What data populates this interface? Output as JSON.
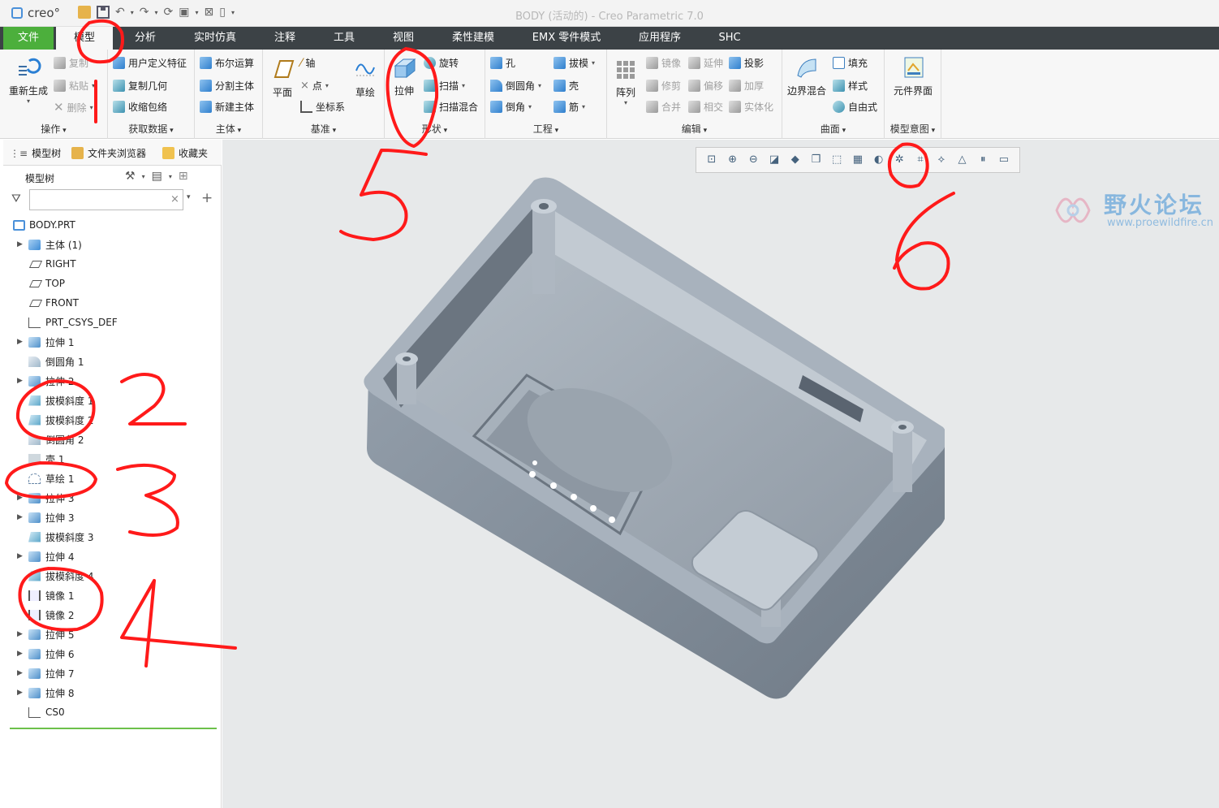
{
  "window": {
    "title": "BODY (活动的) - Creo Parametric 7.0",
    "app_logo": "creo°"
  },
  "ribbon_tabs": [
    "文件",
    "模型",
    "分析",
    "实时仿真",
    "注释",
    "工具",
    "视图",
    "柔性建模",
    "EMX 零件模式",
    "应用程序",
    "SHC"
  ],
  "ribbon": {
    "operations": {
      "label": "操作",
      "regenerate": "重新生成",
      "copy": "复制",
      "paste": "粘贴",
      "delete": "删除"
    },
    "get_data": {
      "label": "获取数据",
      "udf": "用户定义特征",
      "copy_geom": "复制几何",
      "shrinkwrap": "收缩包络"
    },
    "body": {
      "label": "主体",
      "boolean": "布尔运算",
      "split": "分割主体",
      "new_body": "新建主体"
    },
    "datum": {
      "label": "基准",
      "plane": "平面",
      "axis": "轴",
      "point": "点",
      "csys": "坐标系",
      "sketch": "草绘"
    },
    "shapes": {
      "label": "形状",
      "extrude": "拉伸",
      "revolve": "旋转",
      "sweep": "扫描",
      "swept_blend": "扫描混合"
    },
    "engineering": {
      "label": "工程",
      "hole": "孔",
      "round": "倒圆角",
      "chamfer": "倒角",
      "draft": "拔模",
      "shell": "壳",
      "rib": "筋"
    },
    "editing": {
      "label": "编辑",
      "pattern": "阵列",
      "mirror": "镜像",
      "extend": "延伸",
      "project": "投影",
      "trim": "修剪",
      "offset": "偏移",
      "thicken": "加厚",
      "merge": "合并",
      "intersect": "相交",
      "solidify": "实体化"
    },
    "surfaces": {
      "label": "曲面",
      "boundary_blend": "边界混合",
      "fill": "填充",
      "style": "样式",
      "freestyle": "自由式"
    },
    "model_intent": {
      "label": "模型意图",
      "component_interface": "元件界面"
    }
  },
  "nav_tabs": {
    "model_tree": "模型树",
    "folder_browser": "文件夹浏览器",
    "favorites": "收藏夹"
  },
  "tree": {
    "title": "模型树",
    "search_placeholder": "",
    "items": [
      {
        "label": "BODY.PRT",
        "icon": "part-icon",
        "expand": false
      },
      {
        "label": "主体 (1)",
        "icon": "body-icon",
        "expand": true
      },
      {
        "label": "RIGHT",
        "icon": "datum-plane-icon",
        "expand": false
      },
      {
        "label": "TOP",
        "icon": "datum-plane-icon",
        "expand": false
      },
      {
        "label": "FRONT",
        "icon": "datum-plane-icon",
        "expand": false
      },
      {
        "label": "PRT_CSYS_DEF",
        "icon": "csys-icon",
        "expand": false
      },
      {
        "label": "拉伸 1",
        "icon": "extrude-icon",
        "expand": true
      },
      {
        "label": "倒圆角 1",
        "icon": "round-icon",
        "expand": false
      },
      {
        "label": "拉伸 2",
        "icon": "extrude-icon",
        "expand": true
      },
      {
        "label": "拔模斜度 1",
        "icon": "draft-icon",
        "expand": false
      },
      {
        "label": "拔模斜度 2",
        "icon": "draft-icon",
        "expand": false
      },
      {
        "label": "倒圆角 2",
        "icon": "round-icon",
        "expand": false
      },
      {
        "label": "壳 1",
        "icon": "shell-icon",
        "expand": false
      },
      {
        "label": "草绘 1",
        "icon": "sketch-icon",
        "expand": false
      },
      {
        "label": "拉伸 3",
        "icon": "extrude-icon",
        "expand": true
      },
      {
        "label": "拉伸 3",
        "icon": "extrude-icon",
        "expand": true
      },
      {
        "label": "拔模斜度 3",
        "icon": "draft-icon",
        "expand": false
      },
      {
        "label": "拉伸 4",
        "icon": "extrude-icon",
        "expand": true
      },
      {
        "label": "拔模斜度 4",
        "icon": "draft-icon",
        "expand": false
      },
      {
        "label": "镜像 1",
        "icon": "mirror-icon",
        "expand": false
      },
      {
        "label": "镜像 2",
        "icon": "mirror-icon",
        "expand": false
      },
      {
        "label": "拉伸 5",
        "icon": "extrude-icon",
        "expand": true
      },
      {
        "label": "拉伸 6",
        "icon": "extrude-icon",
        "expand": true
      },
      {
        "label": "拉伸 7",
        "icon": "extrude-icon",
        "expand": true
      },
      {
        "label": "拉伸 8",
        "icon": "extrude-icon",
        "expand": true
      },
      {
        "label": "CS0",
        "icon": "csys-icon",
        "expand": false
      }
    ]
  },
  "annotations": [
    "1",
    "2",
    "3",
    "4",
    "5",
    "6"
  ],
  "watermark": {
    "text": "野火论坛",
    "url": "www.proewildfire.cn"
  },
  "colors": {
    "file_tab": "#4caf3c",
    "tabbar": "#3c4246",
    "annotation": "#ff1a1a",
    "model": "#8a96a3",
    "tree_end": "#6cc04a"
  }
}
